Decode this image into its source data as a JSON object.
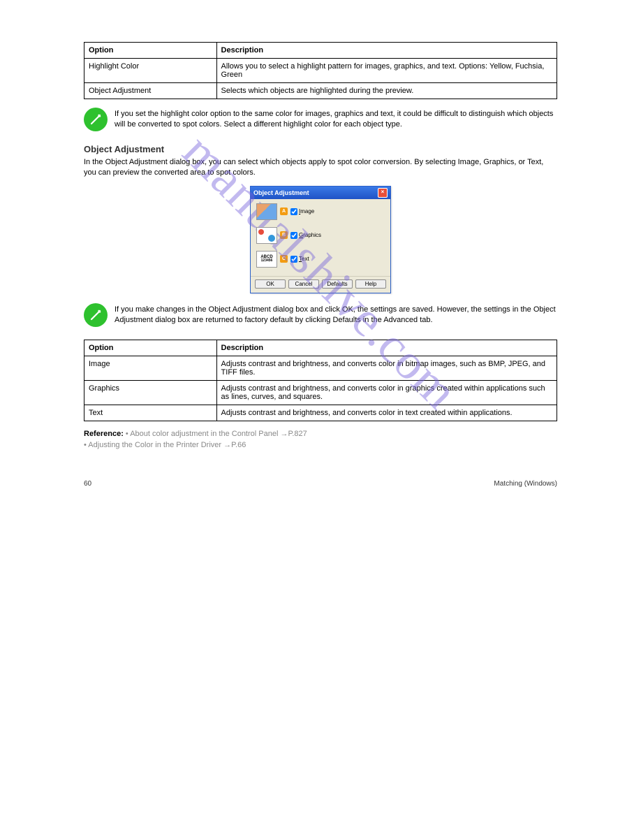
{
  "watermark": "manualshive.com",
  "table1": {
    "headers": [
      "Option",
      "Description"
    ],
    "rows": [
      [
        "Highlight Color",
        "Allows you to select a highlight pattern for images, graphics, and text.\nOptions: Yellow, Fuchsia, Green"
      ],
      [
        "Object Adjustment",
        "Selects which objects are highlighted during the preview."
      ]
    ]
  },
  "note1": "If you set the highlight color option to the same color for images, graphics and text, it could be difficult to distinguish which objects will be converted to spot colors. Select a different highlight color for each object type.",
  "section_heading": "Object Adjustment",
  "section_para": "In the Object Adjustment dialog box, you can select which objects apply to spot color conversion. By selecting Image, Graphics, or Text, you can preview the converted area to spot colors.",
  "dialog": {
    "title": "Object Adjustment",
    "items": [
      {
        "letter": "A",
        "label": "Image",
        "ul": "I"
      },
      {
        "letter": "B",
        "label": "Graphics",
        "ul": "G"
      },
      {
        "letter": "C",
        "label": "Text",
        "ul": "T"
      }
    ],
    "buttons": [
      "OK",
      "Cancel",
      "Defaults",
      "Help"
    ]
  },
  "note2": "If you make changes in the Object Adjustment dialog box and click OK, the settings are saved. However, the settings in the Object Adjustment dialog box are returned to factory default by clicking Defaults in the Advanced tab.",
  "table2": {
    "headers": [
      "Option",
      "Description"
    ],
    "rows": [
      [
        "Image",
        "Adjusts contrast and brightness, and converts color in bitmap images, such as BMP, JPEG, and TIFF files."
      ],
      [
        "Graphics",
        "Adjusts contrast and brightness, and converts color in graphics created within applications such as lines, curves, and squares."
      ],
      [
        "Text",
        "Adjusts contrast and brightness, and converts color in text created within applications."
      ]
    ]
  },
  "refs": [
    {
      "label": "Reference:",
      "text": "• About color adjustment in the Control Panel →P.827"
    },
    {
      "text": "• Adjusting the Color in the Printer Driver →P.66"
    }
  ],
  "footer_left": "60",
  "footer_right": "Matching (Windows)"
}
